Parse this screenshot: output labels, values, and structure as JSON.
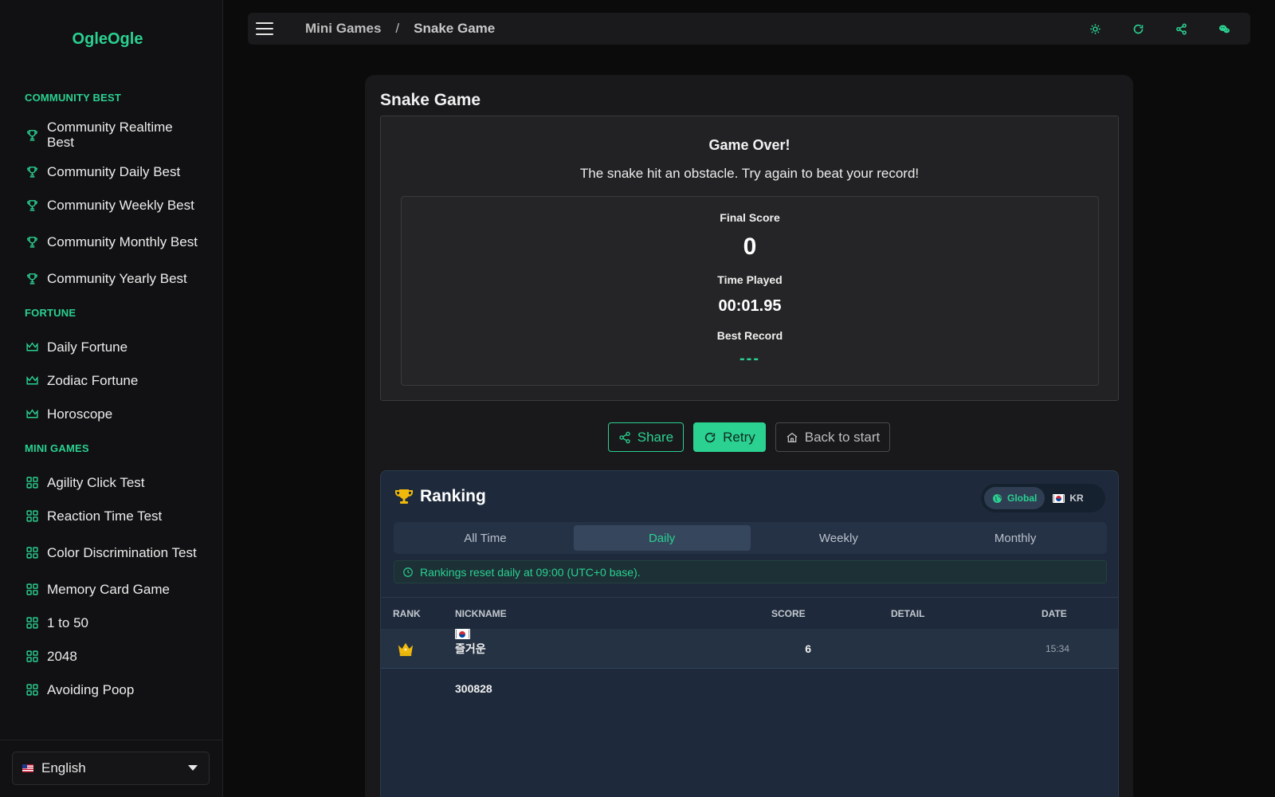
{
  "app": {
    "name": "OgleOgle"
  },
  "sidebar": {
    "sections": [
      {
        "heading": "COMMUNITY BEST",
        "items": [
          {
            "label": "Community Realtime Best",
            "icon": "trophy-icon"
          },
          {
            "label": "Community Daily Best",
            "icon": "trophy-icon"
          },
          {
            "label": "Community Weekly Best",
            "icon": "trophy-icon"
          },
          {
            "label": "Community Monthly Best",
            "icon": "trophy-icon"
          },
          {
            "label": "Community Yearly Best",
            "icon": "trophy-icon"
          }
        ]
      },
      {
        "heading": "FORTUNE",
        "items": [
          {
            "label": "Daily Fortune",
            "icon": "crown-icon"
          },
          {
            "label": "Zodiac Fortune",
            "icon": "crown-icon"
          },
          {
            "label": "Horoscope",
            "icon": "crown-icon"
          }
        ]
      },
      {
        "heading": "MINI GAMES",
        "items": [
          {
            "label": "Agility Click Test",
            "icon": "grid-icon"
          },
          {
            "label": "Reaction Time Test",
            "icon": "grid-icon"
          },
          {
            "label": "Color Discrimination Test",
            "icon": "grid-icon"
          },
          {
            "label": "Memory Card Game",
            "icon": "grid-icon"
          },
          {
            "label": "1 to 50",
            "icon": "grid-icon"
          },
          {
            "label": "2048",
            "icon": "grid-icon"
          },
          {
            "label": "Avoiding Poop",
            "icon": "grid-icon"
          }
        ]
      }
    ],
    "language": {
      "selected": "English"
    }
  },
  "topbar": {
    "breadcrumb": {
      "parent": "Mini Games",
      "separator": "/",
      "current": "Snake Game"
    },
    "icons": [
      "sun-icon",
      "refresh-icon",
      "share-icon",
      "chat-icon"
    ]
  },
  "game": {
    "title": "Snake Game",
    "over_title": "Game Over!",
    "over_message": "The snake hit an obstacle. Try again to beat your record!",
    "final_score_label": "Final Score",
    "final_score": "0",
    "time_played_label": "Time Played",
    "time_played": "00:01.95",
    "best_record_label": "Best Record",
    "best_record": "---",
    "actions": {
      "share": "Share",
      "retry": "Retry",
      "back": "Back to start"
    }
  },
  "ranking": {
    "title": "Ranking",
    "scope": {
      "global": "Global",
      "kr": "KR",
      "selected": "Global"
    },
    "tabs": [
      "All Time",
      "Daily",
      "Weekly",
      "Monthly"
    ],
    "active_tab": "Daily",
    "notice": "Rankings reset daily at 09:00 (UTC+0 base).",
    "columns": {
      "rank": "RANK",
      "nickname": "NICKNAME",
      "score": "SCORE",
      "detail": "DETAIL",
      "date": "DATE"
    },
    "rows": [
      {
        "rank_icon": "crown-icon",
        "flag": "KR",
        "nickname": "즐거운300828",
        "score": "6",
        "detail": "",
        "date": "15:34"
      }
    ]
  },
  "colors": {
    "accent": "#2ad191",
    "background": "#0b0b0c",
    "ranking_bg": "#1e2a3b",
    "gold": "#f0b90b"
  }
}
